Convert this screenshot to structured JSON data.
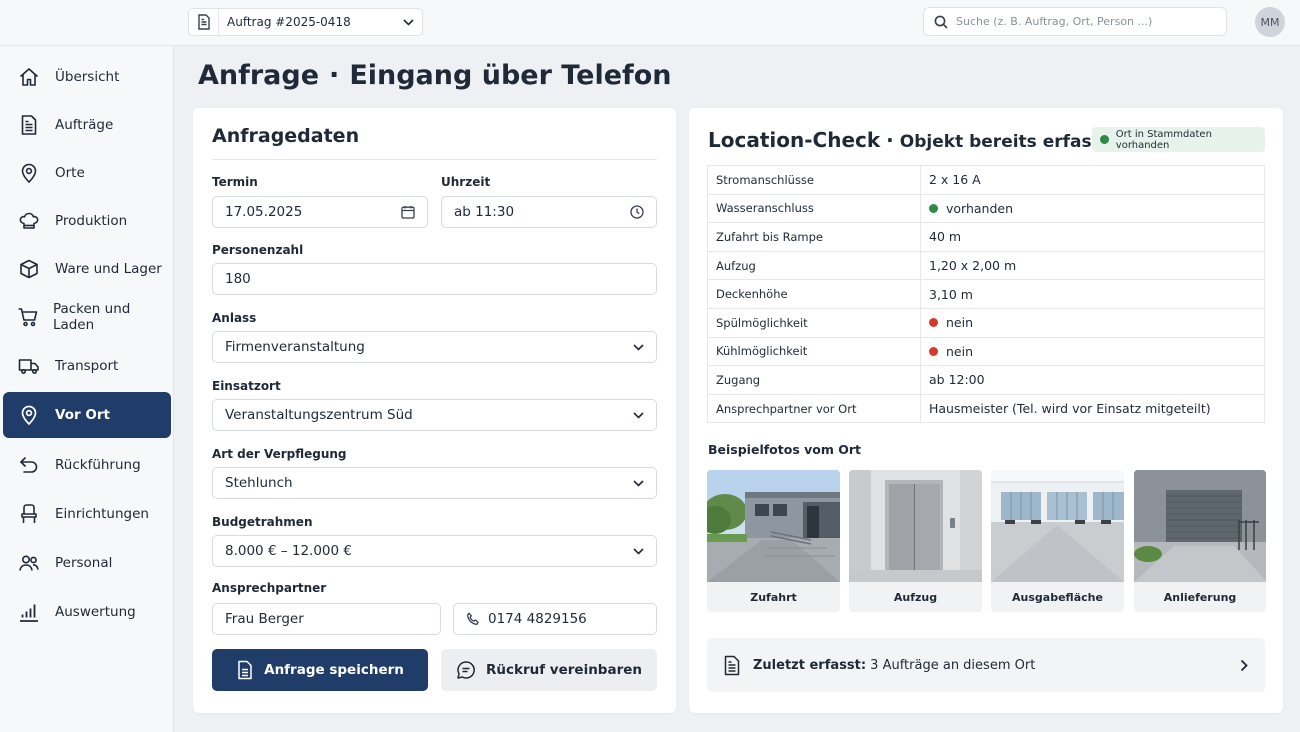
{
  "topbar": {
    "order_selector": "Auftrag #2025-0418",
    "search_placeholder": "Suche (z. B. Auftrag, Ort, Person ...)",
    "avatar_initials": "MM"
  },
  "sidebar": {
    "items": [
      {
        "label": "Übersicht",
        "icon": "home-icon"
      },
      {
        "label": "Aufträge",
        "icon": "document-icon"
      },
      {
        "label": "Orte",
        "icon": "map-pin-icon"
      },
      {
        "label": "Produktion",
        "icon": "chef-hat-icon"
      },
      {
        "label": "Ware und Lager",
        "icon": "box-icon"
      },
      {
        "label": "Packen und Laden",
        "icon": "cart-icon"
      },
      {
        "label": "Transport",
        "icon": "truck-icon"
      },
      {
        "label": "Vor Ort",
        "icon": "map-pin-icon",
        "active": true
      },
      {
        "label": "Rückführung",
        "icon": "return-arrow-icon"
      },
      {
        "label": "Einrichtungen",
        "icon": "chair-icon"
      },
      {
        "label": "Personal",
        "icon": "users-icon"
      },
      {
        "label": "Auswertung",
        "icon": "bar-chart-icon"
      }
    ]
  },
  "page": {
    "title_main": "Anfrage",
    "title_sep": "·",
    "title_sub": "Eingang über Telefon"
  },
  "form": {
    "section_title": "Anfragedaten",
    "termin_label": "Termin",
    "termin_value": "17.05.2025",
    "uhrzeit_label": "Uhrzeit",
    "uhrzeit_value": "ab 11:30",
    "personen_label": "Personenzahl",
    "personen_value": "180",
    "anlass_label": "Anlass",
    "anlass_value": "Firmenveranstaltung",
    "einsatzort_label": "Einsatzort",
    "einsatzort_value": "Veranstaltungszentrum Süd",
    "verpflegung_label": "Art der Verpflegung",
    "verpflegung_value": "Stehlunch",
    "budget_label": "Budgetrahmen",
    "budget_value": "8.000 € – 12.000 €",
    "ansprechpartner_label": "Ansprechpartner",
    "ansprechpartner_value": "Frau Berger",
    "telefon_value": "0174 4829156",
    "save_label": "Anfrage speichern",
    "callback_label": "Rückruf vereinbaren"
  },
  "location": {
    "title": "Location-Check",
    "sep": "·",
    "subtitle": "Objekt bereits erfasst",
    "badge": "Ort in Stammdaten vorhanden",
    "rows": [
      {
        "key": "Stromanschlüsse",
        "value": "2 x 16 A"
      },
      {
        "key": "Wasseranschluss",
        "value": "vorhanden",
        "status": "green"
      },
      {
        "key": "Zufahrt bis Rampe",
        "value": "40 m"
      },
      {
        "key": "Aufzug",
        "value": "1,20 x 2,00 m"
      },
      {
        "key": "Deckenhöhe",
        "value": "3,10 m"
      },
      {
        "key": "Spülmöglichkeit",
        "value": "nein",
        "status": "red"
      },
      {
        "key": "Kühlmöglichkeit",
        "value": "nein",
        "status": "red"
      },
      {
        "key": "Zugang",
        "value": "ab 12:00"
      },
      {
        "key": "Ansprechpartner vor Ort",
        "value": "Hausmeister (Tel. wird vor Einsatz mitgeteilt)"
      }
    ],
    "photos_title": "Beispielfotos vom Ort",
    "photos": [
      "Zufahrt",
      "Aufzug",
      "Ausgabefläche",
      "Anlieferung"
    ],
    "recent_bold": "Zuletzt erfasst:",
    "recent_text": "3 Aufträge an diesem Ort"
  },
  "colors": {
    "primary": "#203c68",
    "status_green": "#2e8b47",
    "status_red": "#d23b2c",
    "badge_bg": "#e7f3ea"
  }
}
